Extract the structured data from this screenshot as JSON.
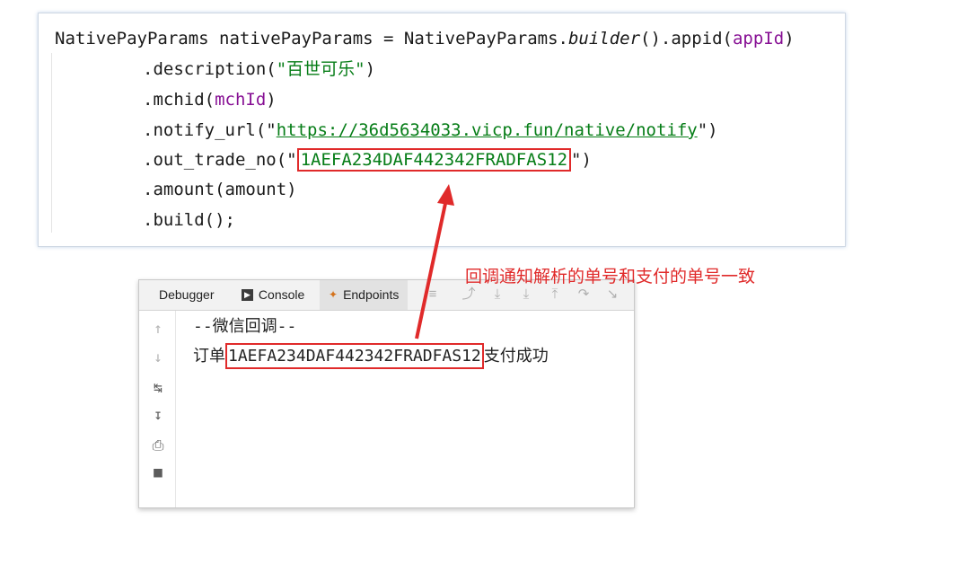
{
  "code": {
    "line1": {
      "a": "NativePayParams nativePayParams = NativePayParams.",
      "b": "builder",
      "c": "().appid(",
      "d": "appId",
      "e": ")"
    },
    "line2": {
      "a": ".description(",
      "b": "\"百世可乐\"",
      "c": ")"
    },
    "line3": {
      "a": ".mchid(",
      "b": "mchId",
      "c": ")"
    },
    "line4": {
      "a": ".notify_url(\"",
      "b": "https://36d5634033.vicp.fun/native/notify",
      "c": "\")"
    },
    "line5": {
      "a": ".out_trade_no(\"",
      "b": "1AEFA234DAF442342FRADFAS12",
      "c": "\")"
    },
    "line6": ".amount(amount)",
    "line7": ".build();"
  },
  "console": {
    "tabs": [
      {
        "label": "Debugger",
        "icon": "debugger-icon"
      },
      {
        "label": "Console",
        "icon": "console-icon"
      },
      {
        "label": "Endpoints",
        "icon": "endpoints-icon"
      }
    ],
    "output": {
      "line1": "--微信回调--",
      "line2_prefix": "订单",
      "line2_order": "1AEFA234DAF442342FRADFAS12",
      "line2_suffix": "支付成功"
    }
  },
  "annotation": {
    "text": "回调通知解析的单号和支付的单号一致",
    "color": "#e02a2a"
  }
}
